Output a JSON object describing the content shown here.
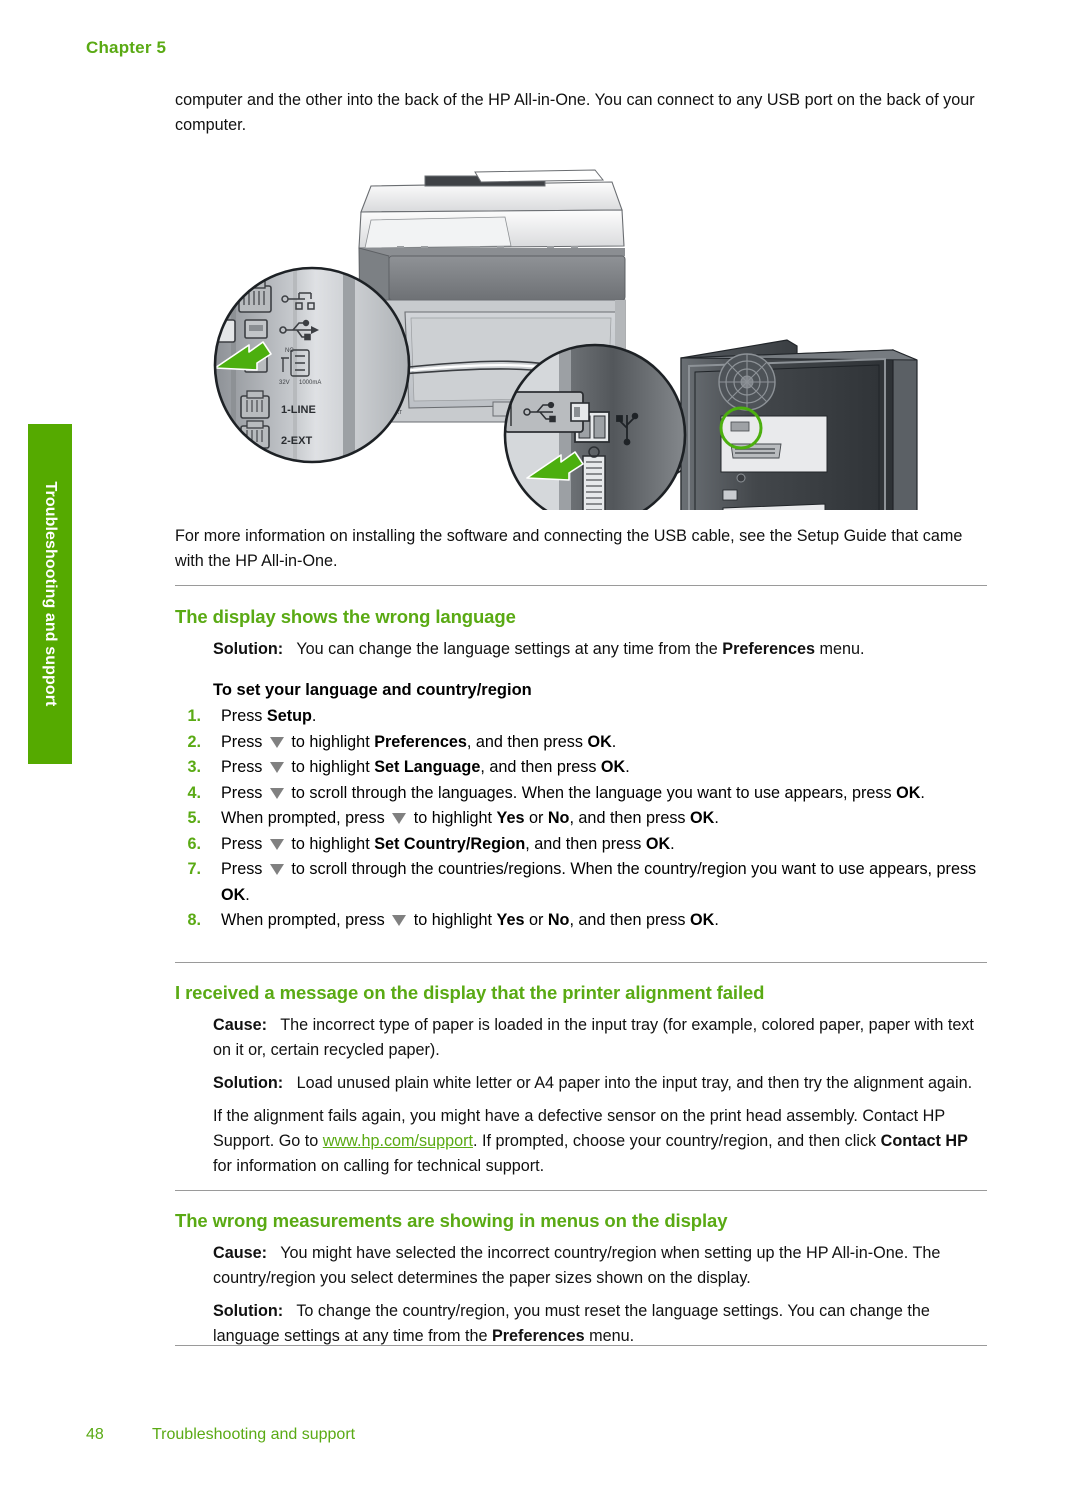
{
  "header": {
    "chapter": "Chapter 5"
  },
  "side_tab": {
    "label": "Troubleshooting and support"
  },
  "colors": {
    "heading_green": "#5aaa14",
    "tab_green": "#55aa00",
    "rule_gray": "#9a9a9a",
    "arrow_green": "#4caf0f"
  },
  "intro": {
    "paragraph": "computer and the other into the back of the HP All-in-One. You can connect to any USB port on the back of your computer."
  },
  "figure": {
    "name": "usb-connection-illustration",
    "caption_labels": {
      "port_1_line": "1-LINE",
      "port_2_ext": "2-EXT",
      "voltage": "32V",
      "current": "1000mA",
      "nc": "NC"
    },
    "icons": [
      "network-port-icon",
      "usb-port-icon",
      "power-port-icon",
      "usb-plug-icon",
      "green-arrow-icon",
      "callout-circle"
    ]
  },
  "after_figure": {
    "paragraph": "For more information on installing the software and connecting the USB cable, see the Setup Guide that came with the HP All-in-One."
  },
  "sections": [
    {
      "id": "wrong-language",
      "heading": "The display shows the wrong language",
      "solution_label": "Solution:",
      "solution_text_a": "You can change the language settings at any time from the ",
      "solution_bold": "Preferences",
      "solution_text_b": " menu.",
      "procedure_title": "To set your language and country/region",
      "steps": [
        {
          "num": "1.",
          "parts": [
            {
              "t": "Press "
            },
            {
              "b": "Setup"
            },
            {
              "t": "."
            }
          ]
        },
        {
          "num": "2.",
          "parts": [
            {
              "t": "Press "
            },
            {
              "tri": true
            },
            {
              "t": " to highlight "
            },
            {
              "b": "Preferences"
            },
            {
              "t": ", and then press "
            },
            {
              "b": "OK"
            },
            {
              "t": "."
            }
          ]
        },
        {
          "num": "3.",
          "parts": [
            {
              "t": "Press "
            },
            {
              "tri": true
            },
            {
              "t": " to highlight "
            },
            {
              "b": "Set Language"
            },
            {
              "t": ", and then press "
            },
            {
              "b": "OK"
            },
            {
              "t": "."
            }
          ]
        },
        {
          "num": "4.",
          "parts": [
            {
              "t": "Press "
            },
            {
              "tri": true
            },
            {
              "t": " to scroll through the languages. When the language you want to use appears, press "
            },
            {
              "b": "OK"
            },
            {
              "t": "."
            }
          ]
        },
        {
          "num": "5.",
          "parts": [
            {
              "t": "When prompted, press "
            },
            {
              "tri": true
            },
            {
              "t": " to highlight "
            },
            {
              "b": "Yes"
            },
            {
              "t": " or "
            },
            {
              "b": "No"
            },
            {
              "t": ", and then press "
            },
            {
              "b": "OK"
            },
            {
              "t": "."
            }
          ]
        },
        {
          "num": "6.",
          "parts": [
            {
              "t": "Press "
            },
            {
              "tri": true
            },
            {
              "t": " to highlight "
            },
            {
              "b": "Set Country/Region"
            },
            {
              "t": ", and then press "
            },
            {
              "b": "OK"
            },
            {
              "t": "."
            }
          ]
        },
        {
          "num": "7.",
          "parts": [
            {
              "t": "Press "
            },
            {
              "tri": true
            },
            {
              "t": " to scroll through the countries/regions. When the country/region you want to use appears, press "
            },
            {
              "b": "OK"
            },
            {
              "t": "."
            }
          ]
        },
        {
          "num": "8.",
          "parts": [
            {
              "t": "When prompted, press "
            },
            {
              "tri": true
            },
            {
              "t": " to highlight "
            },
            {
              "b": "Yes"
            },
            {
              "t": " or "
            },
            {
              "b": "No"
            },
            {
              "t": ", and then press "
            },
            {
              "b": "OK"
            },
            {
              "t": "."
            }
          ]
        }
      ]
    },
    {
      "id": "alignment-failed",
      "heading": "I received a message on the display that the printer alignment failed",
      "cause_label": "Cause:",
      "cause_text": "The incorrect type of paper is loaded in the input tray (for example, colored paper, paper with text on it or, certain recycled paper).",
      "solution_label": "Solution:",
      "solution_text": "Load unused plain white letter or A4 paper into the input tray, and then try the alignment again.",
      "extra_a": "If the alignment fails again, you might have a defective sensor on the print head assembly. Contact HP Support. Go to ",
      "link_text": "www.hp.com/support",
      "extra_b": ". If prompted, choose your country/region, and then click ",
      "extra_bold": "Contact HP",
      "extra_c": " for information on calling for technical support."
    },
    {
      "id": "wrong-measurements",
      "heading": "The wrong measurements are showing in menus on the display",
      "cause_label": "Cause:",
      "cause_text": "You might have selected the incorrect country/region when setting up the HP All-in-One. The country/region you select determines the paper sizes shown on the display.",
      "solution_label": "Solution:",
      "solution_text_a": "To change the country/region, you must reset the language settings. You can change the language settings at any time from the ",
      "solution_bold": "Preferences",
      "solution_text_b": " menu."
    }
  ],
  "footer": {
    "page_number": "48",
    "label": "Troubleshooting and support"
  }
}
